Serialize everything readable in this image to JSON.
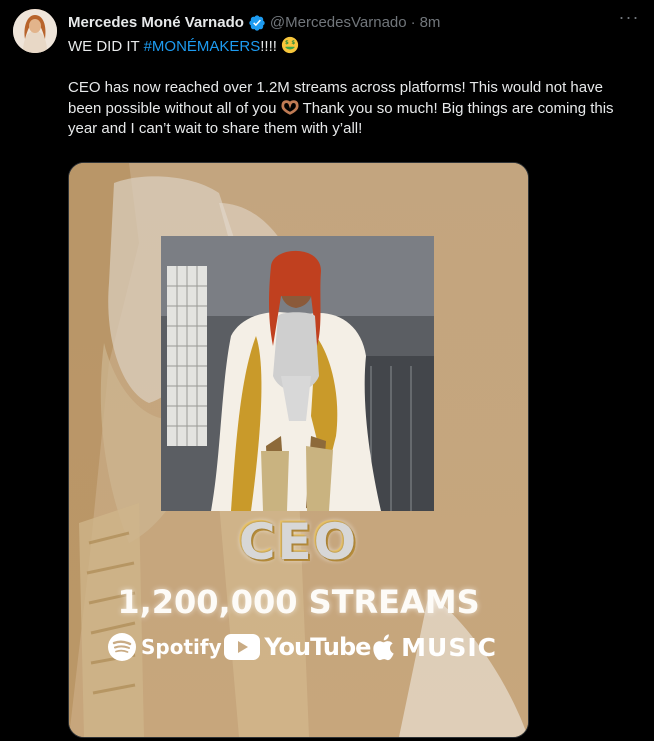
{
  "tweet": {
    "author_name": "Mercedes Moné Varnado",
    "handle": "@MercedesVarnado",
    "separator": "·",
    "time": "8m",
    "more_label": "···",
    "line1_prefix": "WE DID IT ",
    "hashtag": "#MONÉMAKERS",
    "line1_suffix": "!!!!",
    "para_part1": "CEO has now reached over 1.2M streams across platforms! This would not have been possible without all of you",
    "para_part2": "Thank you so much! Big things are coming this year and I can’t wait to share them with y’all!"
  },
  "media": {
    "title": "CEO",
    "streams": "1,200,000 STREAMS",
    "platforms": [
      {
        "icon": "spotify-icon",
        "label": "Spotify"
      },
      {
        "icon": "youtube-icon",
        "label": "YouTube"
      },
      {
        "icon": "apple-icon",
        "label": "MUSIC"
      }
    ]
  },
  "colors": {
    "background": "#000000",
    "text": "#e7e9ea",
    "muted": "#71767b",
    "link": "#1d9bf0",
    "verified": "#1d9bf0",
    "media_bg": "#c9ab84"
  }
}
